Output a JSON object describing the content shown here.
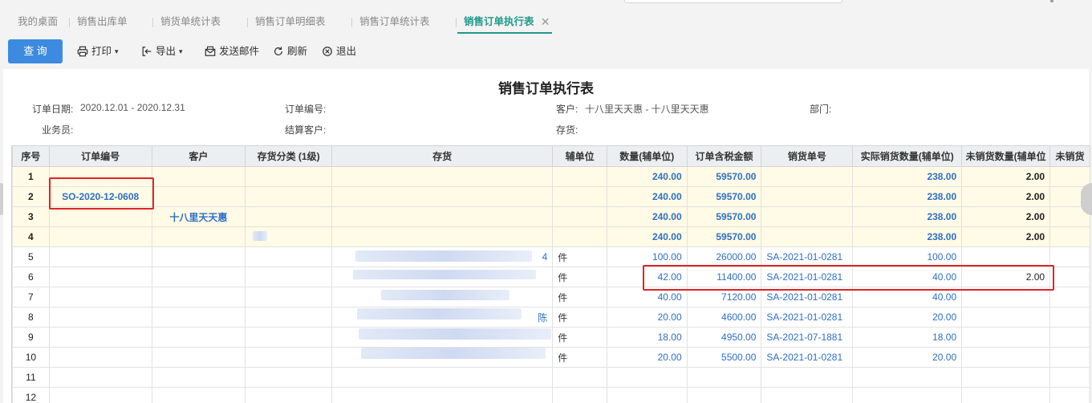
{
  "tabs": [
    {
      "label": "我的桌面"
    },
    {
      "label": "销售出库单"
    },
    {
      "label": "销货单统计表"
    },
    {
      "label": "销售订单明细表"
    },
    {
      "label": "销售订单统计表"
    },
    {
      "label": "销售订单执行表",
      "active": true,
      "close": "✕"
    }
  ],
  "toolbar": {
    "query": "查 询",
    "print": "打印",
    "export": "导出",
    "send_mail": "发送邮件",
    "refresh": "刷新",
    "exit": "退出"
  },
  "report": {
    "title": "销售订单执行表",
    "filters": {
      "order_date_label": "订单日期:",
      "order_date_value": "2020.12.01 - 2020.12.31",
      "order_no_label": "订单编号:",
      "customer_label": "客户:",
      "customer_value": "十八里天天惠 - 十八里天天惠",
      "dept_label": "部门:",
      "salesman_label": "业务员:",
      "settle_customer_label": "结算客户:",
      "stock_label": "存货:"
    }
  },
  "table": {
    "columns": [
      "序号",
      "订单编号",
      "客户",
      "存货分类 (1级)",
      "存货",
      "辅单位",
      "数量(辅单位)",
      "订单含税金额",
      "销货单号",
      "实际销货数量(辅单位)",
      "未销货数量(辅单位",
      "未销货"
    ],
    "rows": [
      {
        "idx": "1",
        "order_no": "",
        "customer": "",
        "category": "",
        "stock": "",
        "unit": "",
        "qty": "240.00",
        "amount": "59570.00",
        "sales_no": "",
        "actual_qty": "238.00",
        "unsold_qty": "2.00",
        "sum": true
      },
      {
        "idx": "2",
        "order_no": "SO-2020-12-0608",
        "customer": "",
        "category": "",
        "stock": "",
        "unit": "",
        "qty": "240.00",
        "amount": "59570.00",
        "sales_no": "",
        "actual_qty": "238.00",
        "unsold_qty": "2.00",
        "sum": true
      },
      {
        "idx": "3",
        "order_no": "",
        "customer": "十八里天天惠",
        "category": "",
        "stock": "",
        "unit": "",
        "qty": "240.00",
        "amount": "59570.00",
        "sales_no": "",
        "actual_qty": "238.00",
        "unsold_qty": "2.00",
        "sum": true
      },
      {
        "idx": "4",
        "order_no": "",
        "customer": "",
        "category": "",
        "stock": "",
        "unit": "",
        "qty": "240.00",
        "amount": "59570.00",
        "sales_no": "",
        "actual_qty": "238.00",
        "unsold_qty": "2.00",
        "sum": true
      },
      {
        "idx": "5",
        "order_no": "",
        "customer": "",
        "category": "",
        "stock": "4",
        "unit": "件",
        "qty": "100.00",
        "amount": "26000.00",
        "sales_no": "SA-2021-01-0281",
        "actual_qty": "100.00",
        "unsold_qty": ""
      },
      {
        "idx": "6",
        "order_no": "",
        "customer": "",
        "category": "",
        "stock": "",
        "unit": "件",
        "qty": "42.00",
        "amount": "11400.00",
        "sales_no": "SA-2021-01-0281",
        "actual_qty": "40.00",
        "unsold_qty": "2.00"
      },
      {
        "idx": "7",
        "order_no": "",
        "customer": "",
        "category": "",
        "stock": "",
        "unit": "件",
        "qty": "40.00",
        "amount": "7120.00",
        "sales_no": "SA-2021-01-0281",
        "actual_qty": "40.00",
        "unsold_qty": ""
      },
      {
        "idx": "8",
        "order_no": "",
        "customer": "",
        "category": "",
        "stock": "陈",
        "unit": "件",
        "qty": "20.00",
        "amount": "4600.00",
        "sales_no": "SA-2021-01-0281",
        "actual_qty": "20.00",
        "unsold_qty": ""
      },
      {
        "idx": "9",
        "order_no": "",
        "customer": "",
        "category": "",
        "stock": "",
        "unit": "件",
        "qty": "18.00",
        "amount": "4950.00",
        "sales_no": "SA-2021-07-1881",
        "actual_qty": "18.00",
        "unsold_qty": ""
      },
      {
        "idx": "10",
        "order_no": "",
        "customer": "",
        "category": "",
        "stock": "",
        "unit": "件",
        "qty": "20.00",
        "amount": "5500.00",
        "sales_no": "SA-2021-01-0281",
        "actual_qty": "20.00",
        "unsold_qty": ""
      },
      {
        "idx": "11",
        "order_no": "",
        "customer": "",
        "category": "",
        "stock": "",
        "unit": "",
        "qty": "",
        "amount": "",
        "sales_no": "",
        "actual_qty": "",
        "unsold_qty": ""
      },
      {
        "idx": "12",
        "order_no": "",
        "customer": "",
        "category": "",
        "stock": "",
        "unit": "",
        "qty": "",
        "amount": "",
        "sales_no": "",
        "actual_qty": "",
        "unsold_qty": ""
      }
    ]
  },
  "colors": {
    "primary": "#3d8be0",
    "active_tab": "#1f9a8a",
    "highlight": "#e02424",
    "summary_row": "#fffbe6"
  }
}
